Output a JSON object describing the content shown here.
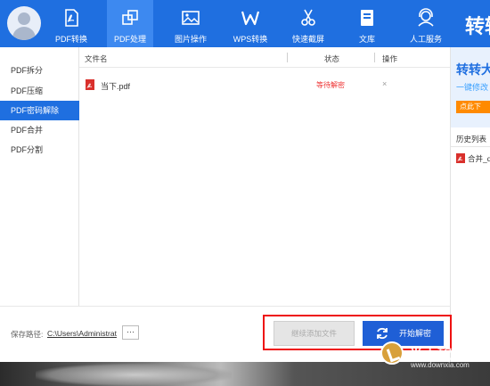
{
  "toolbar": {
    "items": [
      {
        "label": "PDF转换",
        "icon": "pdf-file-icon"
      },
      {
        "label": "PDF处理",
        "icon": "pdf-process-icon"
      },
      {
        "label": "图片操作",
        "icon": "image-icon"
      },
      {
        "label": "WPS转换",
        "icon": "wps-icon"
      },
      {
        "label": "快速截屏",
        "icon": "scissors-icon"
      },
      {
        "label": "文库",
        "icon": "library-icon"
      },
      {
        "label": "人工服务",
        "icon": "support-icon"
      }
    ],
    "active_index": 1,
    "brand_text": "转转",
    "accent_color": "#1f6fe0"
  },
  "sidebar": {
    "items": [
      {
        "label": "PDF拆分"
      },
      {
        "label": "PDF压缩"
      },
      {
        "label": "PDF密码解除"
      },
      {
        "label": "PDF合并"
      },
      {
        "label": "PDF分割"
      }
    ],
    "active_index": 2
  },
  "table": {
    "headers": {
      "filename": "文件名",
      "status": "状态",
      "action": "操作"
    },
    "rows": [
      {
        "filename": "当下.pdf",
        "status": "等待解密",
        "action": "×"
      }
    ]
  },
  "ad": {
    "title": "转转大",
    "subtitle": "一键修改",
    "button": "点此下"
  },
  "history": {
    "title": "历史列表",
    "items": [
      {
        "name": "合并_q"
      }
    ]
  },
  "bottom": {
    "save_label": "保存路径:",
    "save_path": "C:\\Users\\Administrat",
    "more_label": "···",
    "add_label": "继续添加文件",
    "start_label": "开始解密"
  },
  "watermark": {
    "name": "当下软件园",
    "url": "www.downxia.com"
  }
}
